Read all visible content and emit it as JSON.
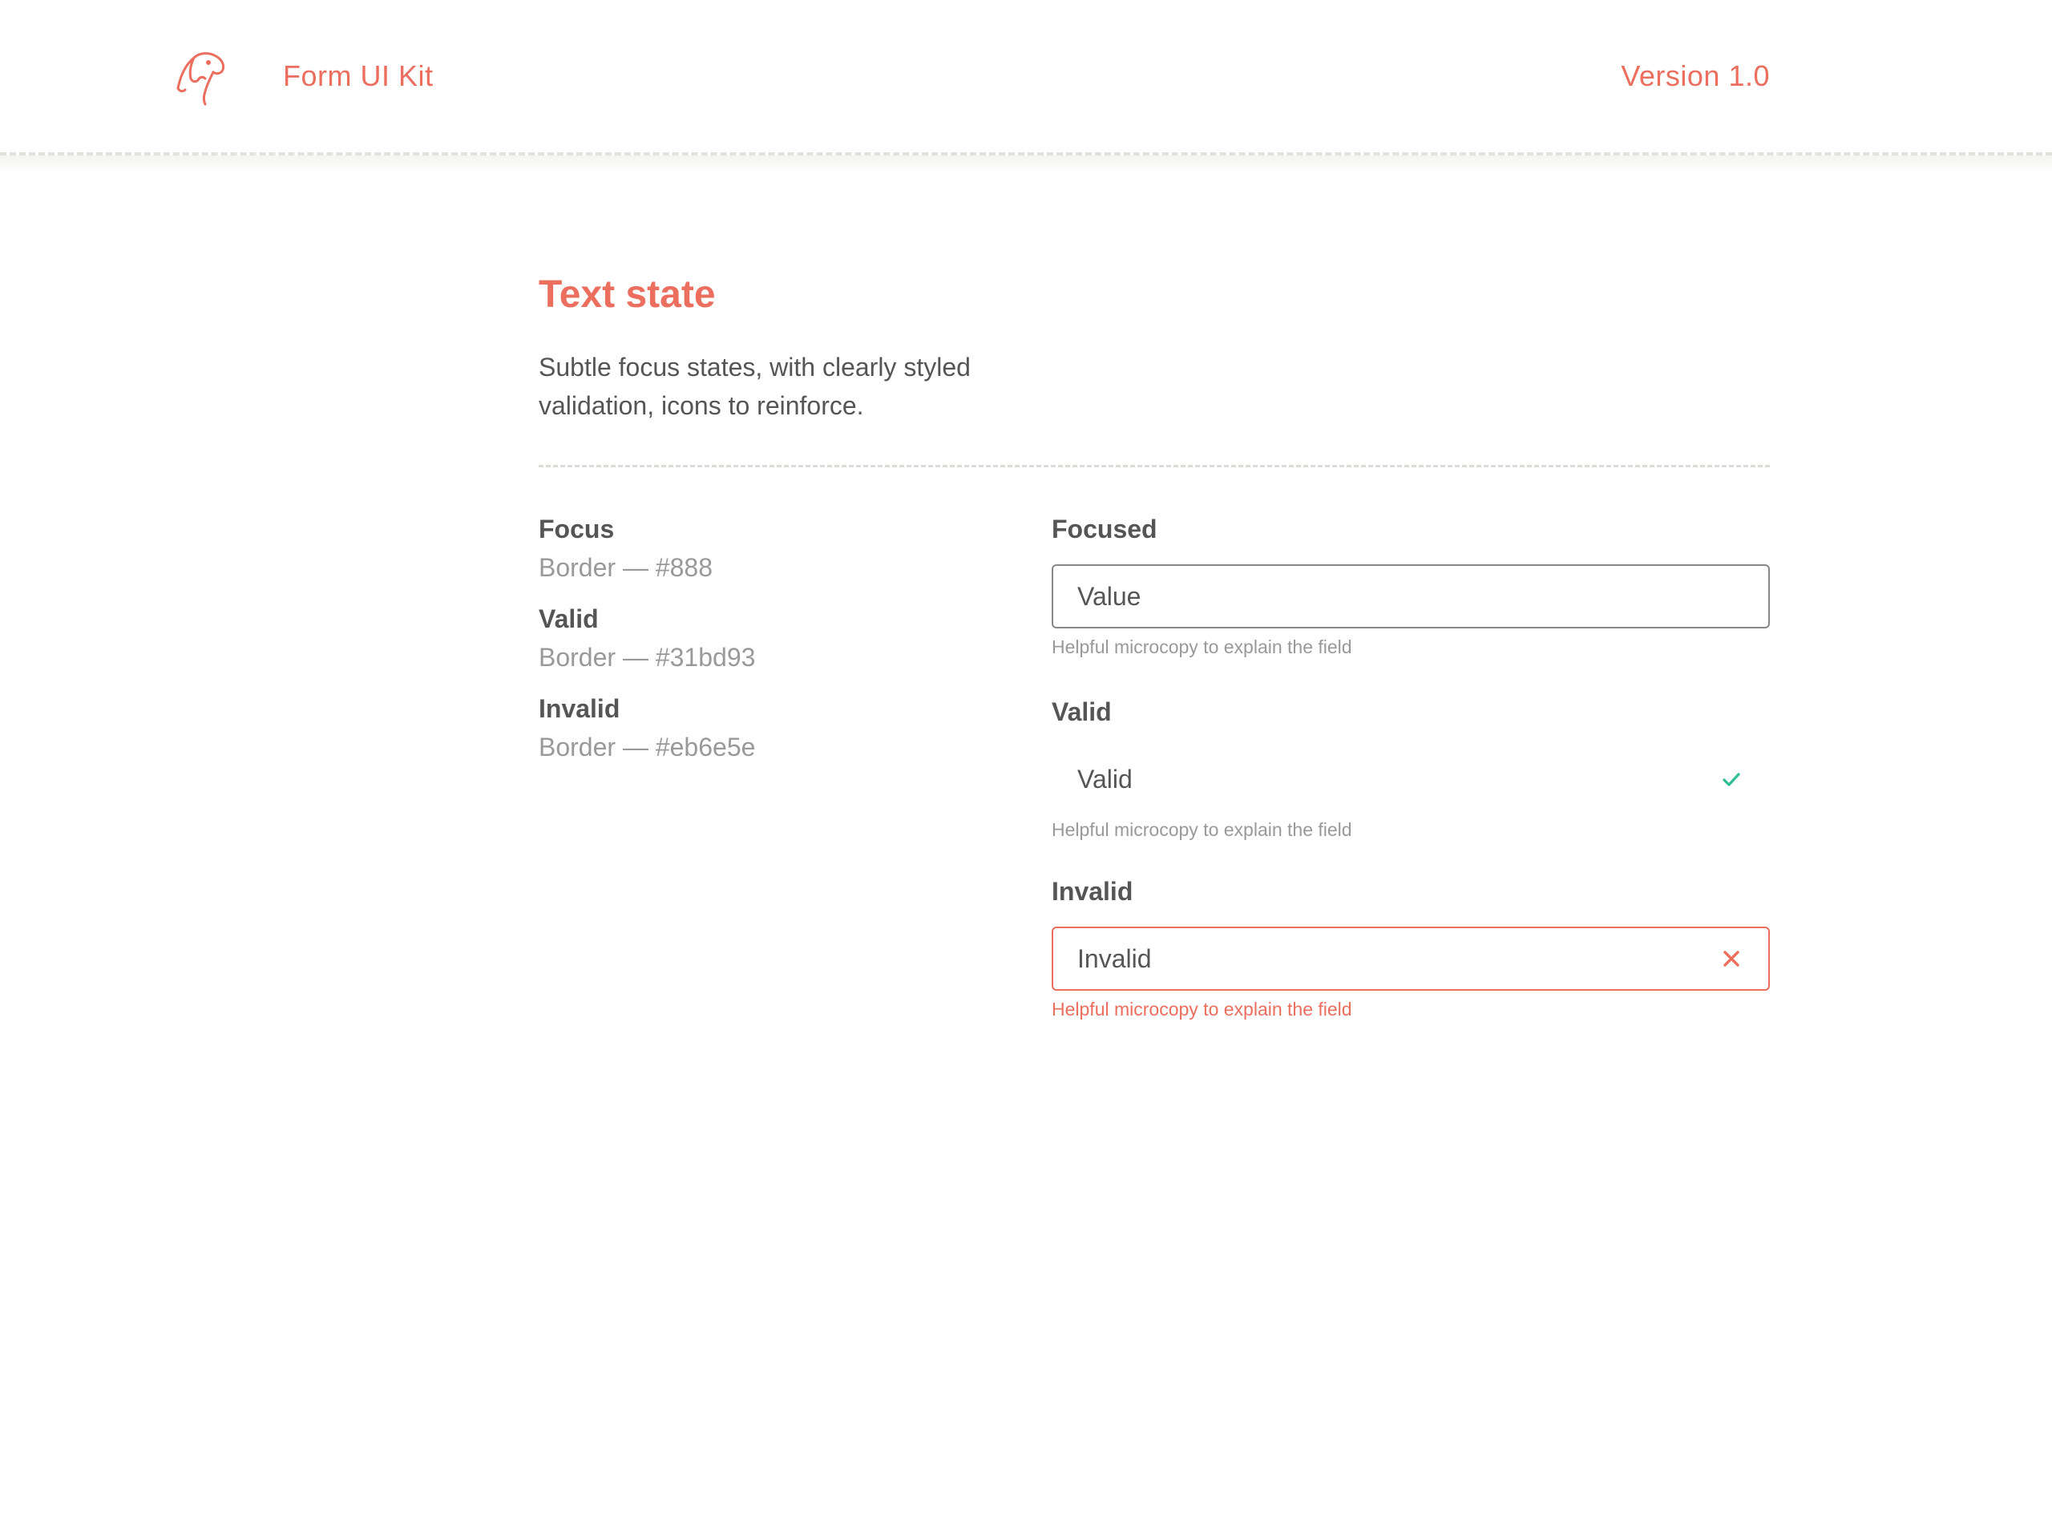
{
  "header": {
    "brand": "Form UI Kit",
    "version": "Version 1.0",
    "logo_icon": "dog-head-icon"
  },
  "intro": {
    "title": "Text state",
    "description": "Subtle focus states, with clearly styled validation, icons to reinforce."
  },
  "legend": {
    "items": [
      {
        "title": "Focus",
        "value": "Border — #888"
      },
      {
        "title": "Valid",
        "value": "Border — #31bd93"
      },
      {
        "title": "Invalid",
        "value": "Border — #eb6e5e"
      }
    ]
  },
  "fields": {
    "focused": {
      "label": "Focused",
      "value": "Value",
      "help": "Helpful microcopy to explain the field"
    },
    "valid": {
      "label": "Valid",
      "value": "Valid",
      "help": "Helpful microcopy to explain the field",
      "icon": "checkmark-icon"
    },
    "invalid": {
      "label": "Invalid",
      "value": "Invalid",
      "help": "Helpful microcopy to explain the field",
      "icon": "close-icon"
    }
  },
  "colors": {
    "accent": "#eb6e5e",
    "focus_border": "#888888",
    "valid": "#31bd93",
    "invalid": "#eb6e5e",
    "text": "#555555",
    "muted": "#999999"
  }
}
